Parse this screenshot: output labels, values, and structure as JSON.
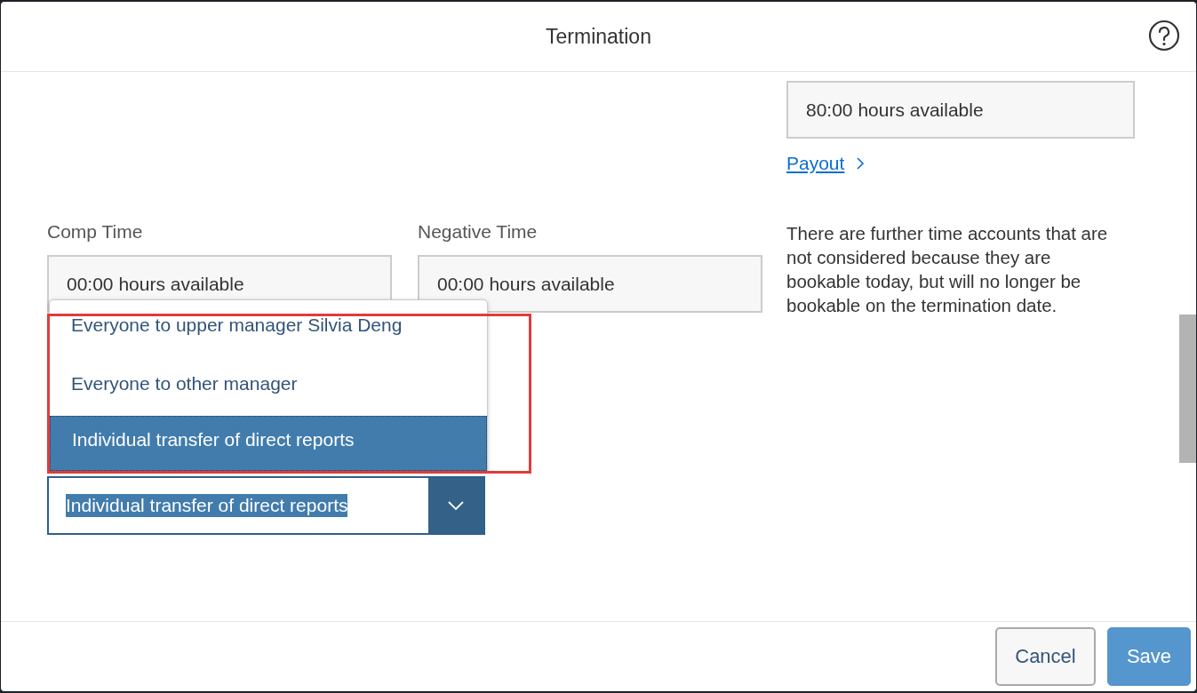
{
  "dialog": {
    "title": "Termination"
  },
  "top_account": {
    "value": "80:00 hours available",
    "link": "Payout"
  },
  "time_fields": [
    {
      "label": "Comp Time",
      "value": "00:00 hours available"
    },
    {
      "label": "Negative Time",
      "value": "00:00 hours available"
    }
  ],
  "note": "There are further time accounts that are not considered because they are bookable today, but will no longer be bookable on the termination date.",
  "transfer_select": {
    "value": "Individual transfer of direct reports",
    "expanded": true,
    "options": [
      {
        "label": "Everyone to upper manager Silvia Deng",
        "selected": false
      },
      {
        "label": "Everyone to other manager",
        "selected": false
      },
      {
        "label": "Individual transfer of direct reports",
        "selected": true
      }
    ]
  },
  "buttons": [
    {
      "label": "Cancel",
      "kind": "secondary"
    },
    {
      "label": "Save",
      "kind": "primary"
    }
  ]
}
